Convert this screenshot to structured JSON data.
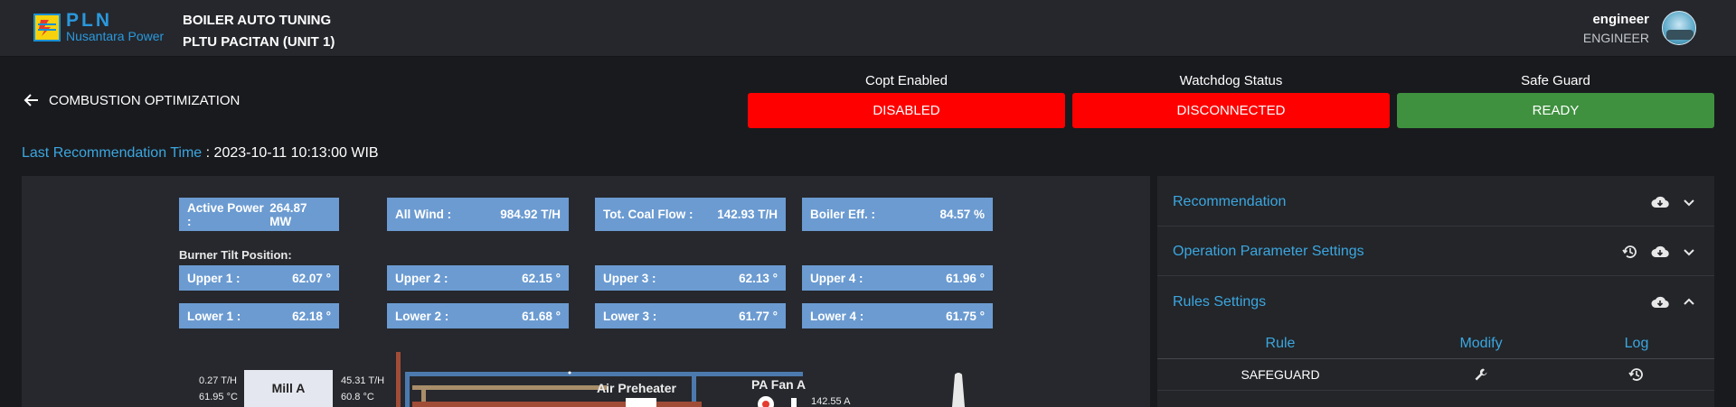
{
  "header": {
    "logo_text": "PLN",
    "logo_sub": "Nusantara Power",
    "app_title": "BOILER AUTO TUNING",
    "plant": "PLTU PACITAN (UNIT 1)",
    "user_name": "engineer",
    "user_role": "ENGINEER"
  },
  "page": {
    "back_label": "COMBUSTION OPTIMIZATION",
    "last_rec_label": "Last Recommendation Time",
    "last_rec_value": ": 2023-10-11 10:13:00 WIB"
  },
  "statuses": [
    {
      "label": "Copt Enabled",
      "value": "DISABLED",
      "color": "#ff0000"
    },
    {
      "label": "Watchdog Status",
      "value": "DISCONNECTED",
      "color": "#ff0000"
    },
    {
      "label": "Safe Guard",
      "value": "READY",
      "color": "#3f913f"
    }
  ],
  "metrics": [
    {
      "label": "Active Power :",
      "value": "264.87 MW"
    },
    {
      "label": "All Wind :",
      "value": "984.92 T/H"
    },
    {
      "label": "Tot. Coal Flow :",
      "value": "142.93 T/H"
    },
    {
      "label": "Boiler Eff. :",
      "value": "84.57 %"
    }
  ],
  "burner_tilt_label": "Burner Tilt Position:",
  "upper": [
    {
      "label": "Upper 1 :",
      "value": "62.07 °"
    },
    {
      "label": "Upper 2 :",
      "value": "62.15 °"
    },
    {
      "label": "Upper 3 :",
      "value": "62.13 °"
    },
    {
      "label": "Upper 4 :",
      "value": "61.96 °"
    }
  ],
  "lower": [
    {
      "label": "Lower 1 :",
      "value": "62.18 °"
    },
    {
      "label": "Lower 2 :",
      "value": "61.68 °"
    },
    {
      "label": "Lower 3 :",
      "value": "61.77 °"
    },
    {
      "label": "Lower 4 :",
      "value": "61.75 °"
    }
  ],
  "diagram": {
    "mill_label": "Mill A",
    "mill_in_flow": "0.27 T/H",
    "mill_in_temp": "61.95 °C",
    "mill_out_flow": "45.31 T/H",
    "mill_out_temp": "60.8 °C",
    "air_preheater": "Air Preheater",
    "pa_fan": "PA Fan A",
    "pa_fan_current": "142.55 A"
  },
  "sidebar": {
    "sections": [
      {
        "title": "Recommendation"
      },
      {
        "title": "Operation Parameter Settings"
      },
      {
        "title": "Rules Settings"
      }
    ],
    "rules_headers": {
      "rule": "Rule",
      "modify": "Modify",
      "log": "Log"
    },
    "rules": [
      {
        "rule": "SAFEGUARD"
      }
    ]
  }
}
